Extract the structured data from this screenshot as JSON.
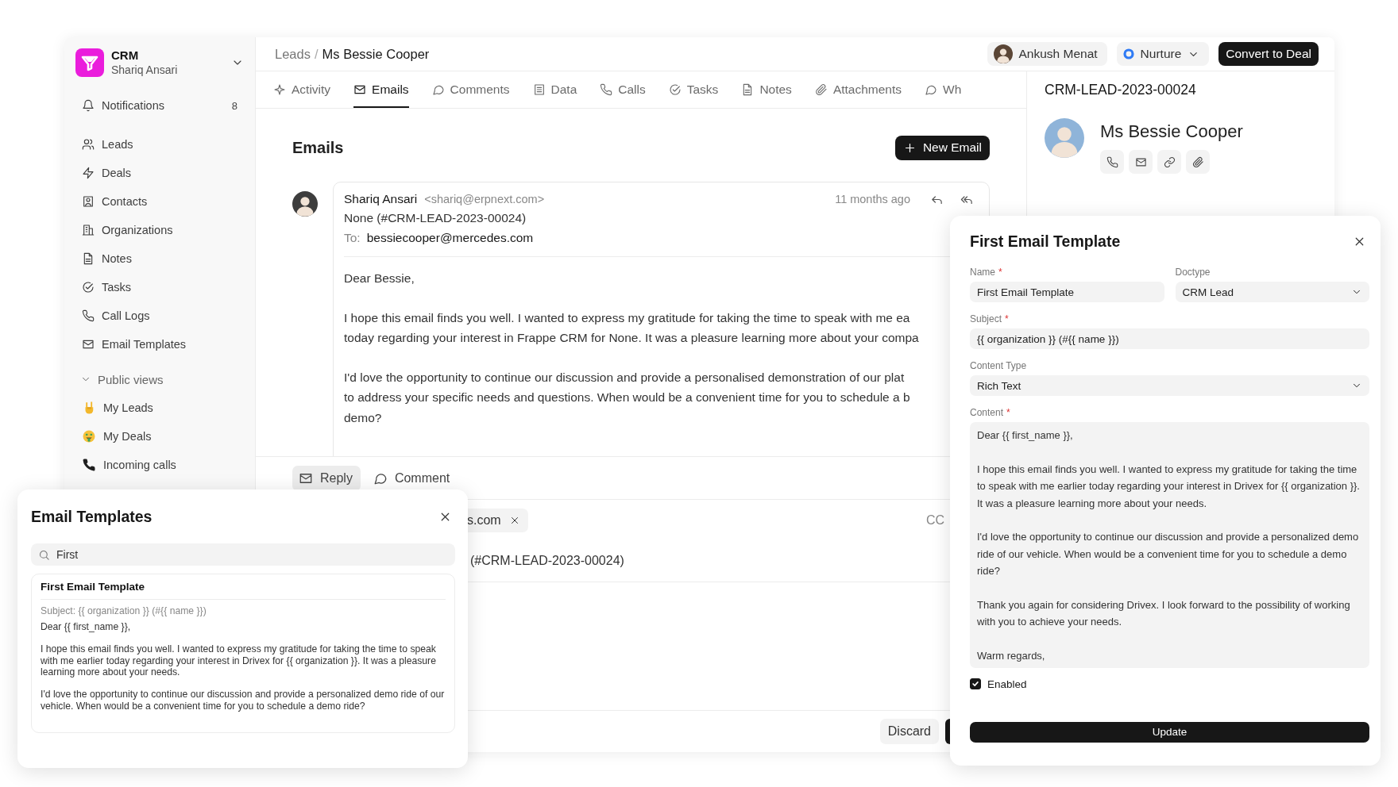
{
  "app": {
    "name": "CRM",
    "user": "Shariq Ansari"
  },
  "sidebar": {
    "notifications": {
      "label": "Notifications",
      "count": "8"
    },
    "items": [
      {
        "label": "Leads",
        "selected": false
      },
      {
        "label": "Deals",
        "selected": false
      },
      {
        "label": "Contacts",
        "selected": false
      },
      {
        "label": "Organizations",
        "selected": false
      },
      {
        "label": "Notes",
        "selected": false
      },
      {
        "label": "Tasks",
        "selected": false
      },
      {
        "label": "Call Logs",
        "selected": false
      },
      {
        "label": "Email Templates",
        "selected": false
      }
    ],
    "public_views": {
      "label": "Public views",
      "expanded": true,
      "items": [
        {
          "label": "My Leads",
          "selected": false
        },
        {
          "label": "My Deals",
          "selected": false
        },
        {
          "label": "Incoming calls",
          "selected": false
        }
      ]
    }
  },
  "header": {
    "breadcrumb": [
      "Leads",
      "Ms Bessie Cooper"
    ],
    "separator": "/",
    "assignee": "Ankush Menat",
    "status": {
      "label": "Nurture",
      "color": "#2f7bf5"
    },
    "convert_button": "Convert to Deal"
  },
  "tabs": [
    {
      "label": "Activity",
      "selected": false
    },
    {
      "label": "Emails",
      "selected": true
    },
    {
      "label": "Comments",
      "selected": false
    },
    {
      "label": "Data",
      "selected": false
    },
    {
      "label": "Calls",
      "selected": false
    },
    {
      "label": "Tasks",
      "selected": false
    },
    {
      "label": "Notes",
      "selected": false
    },
    {
      "label": "Attachments",
      "selected": false
    },
    {
      "label": "Wh",
      "selected": false
    }
  ],
  "emails": {
    "title": "Emails",
    "new_button": "New Email",
    "thread": [
      {
        "sender": "Shariq Ansari",
        "address": "<shariq@erpnext.com>",
        "time": "11 months ago",
        "subject": "None (#CRM-LEAD-2023-00024)",
        "to_label": "To:",
        "to": "bessiecooper@mercedes.com",
        "body": [
          [
            "Dear Bessie,"
          ],
          [
            "I hope this email finds you well. I wanted to express my gratitude for taking the time to speak with me ea",
            "today regarding your interest in Frappe CRM for None. It was a pleasure learning more about your compa"
          ],
          [
            "I'd love the opportunity to continue our discussion and provide a personalised demonstration of our plat",
            "to address your specific needs and questions. When would be a convenient time for you to schedule a b",
            "demo?"
          ]
        ]
      }
    ]
  },
  "composer": {
    "actions": [
      {
        "label": "Reply",
        "selected": true
      },
      {
        "label": "Comment",
        "selected": false
      }
    ],
    "recipient": "s.com",
    "cc": "CC",
    "subject": "(#CRM-LEAD-2023-00024)",
    "discard": "Discard"
  },
  "lead_panel": {
    "id": "CRM-LEAD-2023-00024",
    "name": "Ms Bessie Cooper"
  },
  "templates_popup": {
    "title": "Email Templates",
    "search": {
      "value": "First"
    },
    "results": [
      {
        "name": "First Email Template",
        "subject": "Subject: {{ organization }} (#{{ name }})",
        "body": [
          "Dear {{ first_name }},",
          "I hope this email finds you well. I wanted to express my gratitude for taking the time to speak with me earlier today regarding your interest in Drivex for {{ organization }}. It was a pleasure learning more about your needs.",
          "I'd love the opportunity to continue our discussion and provide a personalized demo ride of our vehicle. When would be a convenient time for you to schedule a demo ride?"
        ]
      }
    ]
  },
  "template_modal": {
    "title": "First Email Template",
    "required_mark": "*",
    "fields": [
      {
        "label": "Name",
        "required": true,
        "kind": "text",
        "value": "First Email Template"
      },
      {
        "label": "Doctype",
        "required": false,
        "kind": "select",
        "value": "CRM Lead"
      },
      {
        "label": "Subject",
        "required": true,
        "kind": "text",
        "value": "{{ organization }} (#{{ name }})"
      },
      {
        "label": "Content Type",
        "required": false,
        "kind": "select",
        "value": "Rich Text"
      },
      {
        "label": "Content",
        "required": true,
        "kind": "textarea",
        "value": "Dear {{ first_name }},\n\nI hope this email finds you well. I wanted to express my gratitude for taking the time to speak with me earlier today regarding your interest in Drivex for {{ organization }}. It was a pleasure learning more about your needs.\n\nI'd love the opportunity to continue our discussion and provide a personalized demo ride of our vehicle. When would be a convenient time for you to schedule a demo ride?\n\nThank you again for considering Drivex. I look forward to the possibility of working with you to achieve your needs.\n\nWarm regards,"
      }
    ],
    "enabled": {
      "label": "Enabled",
      "checked": true
    },
    "submit": "Update"
  }
}
